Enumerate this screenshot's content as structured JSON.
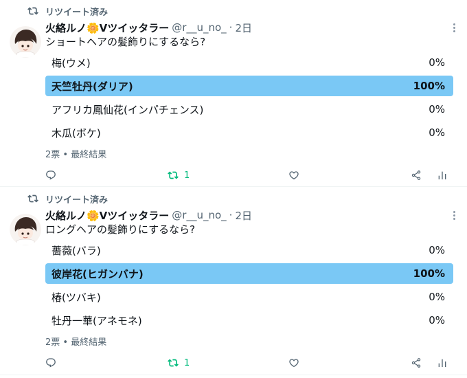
{
  "colors": {
    "text": "#0f1419",
    "secondary": "#536471",
    "winner_fill": "#7ac8f5",
    "other_fill": "#cfd9de",
    "retweet_active": "#00ba7c"
  },
  "tweets": [
    {
      "retweeted_label": "リツイート済み",
      "author_name": "火絡ルノ🌼️Vツイッタラー",
      "handle": "@r__u_no_",
      "time_sep": "·",
      "time": "2日",
      "question": "ショートヘアの髪飾りにするなら?",
      "poll": [
        {
          "label": "梅(ウメ)",
          "percent_text": "0%",
          "percent": 0,
          "winner": false
        },
        {
          "label": "天竺牡丹(ダリア)",
          "percent_text": "100%",
          "percent": 100,
          "winner": true
        },
        {
          "label": "アフリカ鳳仙花(インパチェンス)",
          "percent_text": "0%",
          "percent": 0,
          "winner": false
        },
        {
          "label": "木瓜(ボケ)",
          "percent_text": "0%",
          "percent": 0,
          "winner": false
        }
      ],
      "meta": "2票 • 最終結果",
      "actions": {
        "reply_icon": "reply-icon",
        "retweet_icon": "retweet-icon",
        "retweet_count": "1",
        "like_icon": "heart-icon",
        "share_icon": "share-icon",
        "analytics_icon": "analytics-icon"
      }
    },
    {
      "retweeted_label": "リツイート済み",
      "author_name": "火絡ルノ🌼️Vツイッタラー",
      "handle": "@r__u_no_",
      "time_sep": "·",
      "time": "2日",
      "question": "ロングヘアの髪飾りにするなら?",
      "poll": [
        {
          "label": "薔薇(バラ)",
          "percent_text": "0%",
          "percent": 0,
          "winner": false
        },
        {
          "label": "彼岸花(ヒガンバナ)",
          "percent_text": "100%",
          "percent": 100,
          "winner": true
        },
        {
          "label": "椿(ツバキ)",
          "percent_text": "0%",
          "percent": 0,
          "winner": false
        },
        {
          "label": "牡丹一華(アネモネ)",
          "percent_text": "0%",
          "percent": 0,
          "winner": false
        }
      ],
      "meta": "2票 • 最終結果",
      "actions": {
        "reply_icon": "reply-icon",
        "retweet_icon": "retweet-icon",
        "retweet_count": "1",
        "like_icon": "heart-icon",
        "share_icon": "share-icon",
        "analytics_icon": "analytics-icon"
      }
    }
  ]
}
